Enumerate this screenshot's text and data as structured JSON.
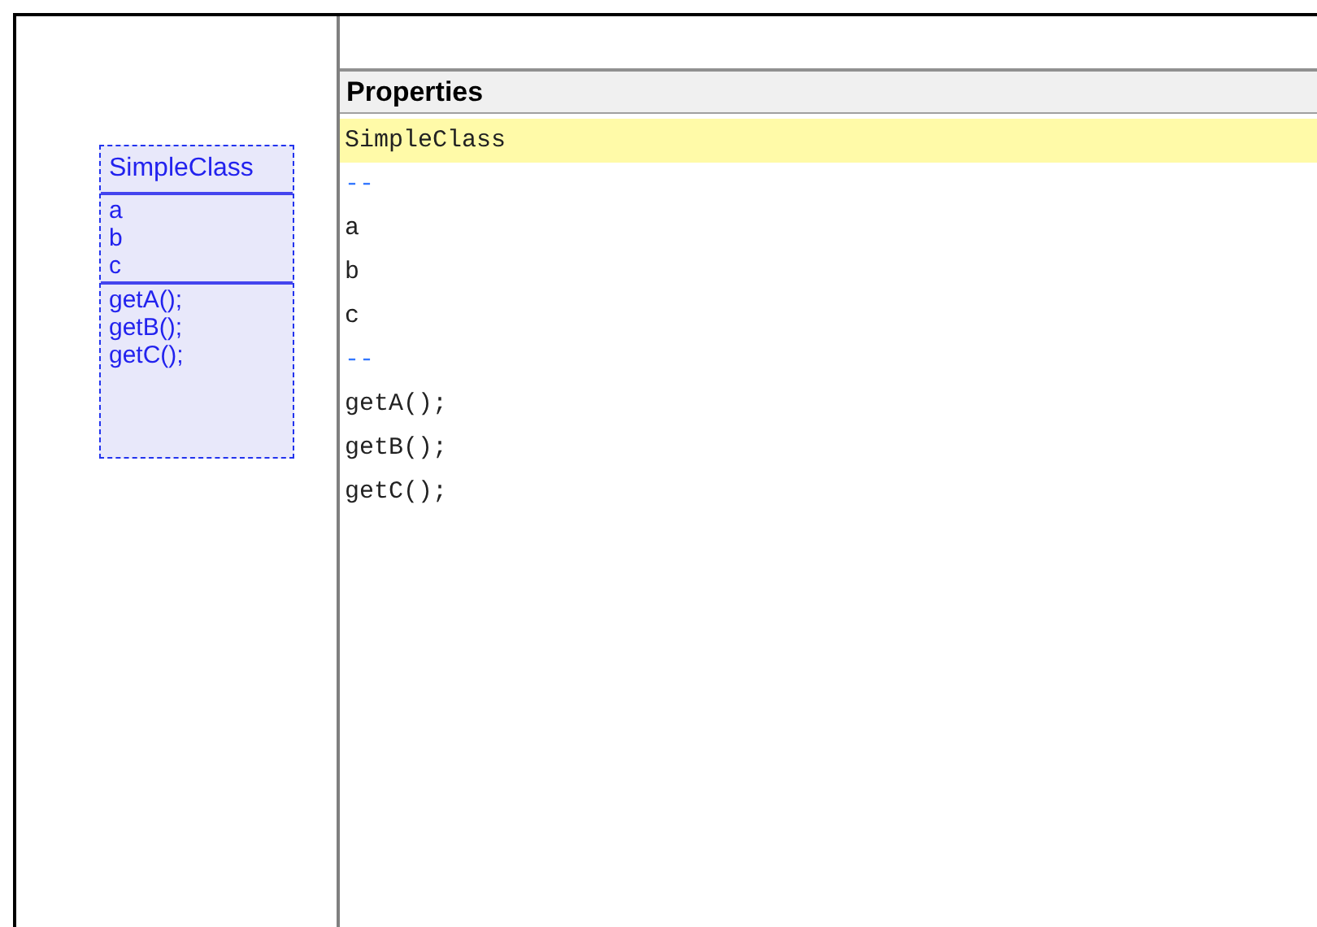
{
  "diagram": {
    "class": {
      "name": "SimpleClass",
      "attributes": [
        "a",
        "b",
        "c"
      ],
      "methods": [
        "getA();",
        "getB();",
        "getC();"
      ]
    }
  },
  "properties": {
    "title": "Properties",
    "lines": [
      {
        "text": "SimpleClass",
        "kind": "text",
        "selected": true
      },
      {
        "text": "--",
        "kind": "separator",
        "selected": false
      },
      {
        "text": "a",
        "kind": "text",
        "selected": false
      },
      {
        "text": "b",
        "kind": "text",
        "selected": false
      },
      {
        "text": "c",
        "kind": "text",
        "selected": false
      },
      {
        "text": "--",
        "kind": "separator",
        "selected": false
      },
      {
        "text": "getA();",
        "kind": "text",
        "selected": false
      },
      {
        "text": "getB();",
        "kind": "text",
        "selected": false
      },
      {
        "text": "getC();",
        "kind": "text",
        "selected": false
      }
    ]
  }
}
